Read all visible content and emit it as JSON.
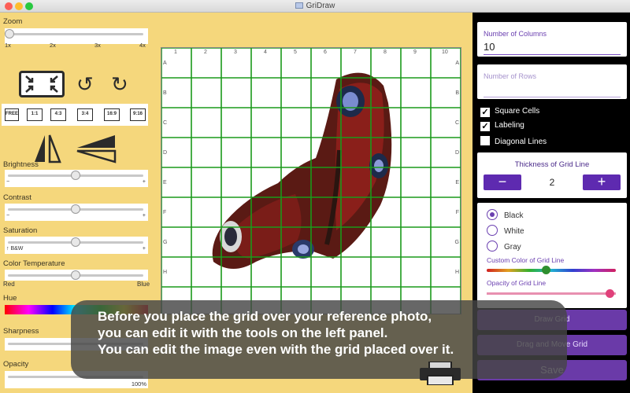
{
  "window": {
    "title": "GriDraw"
  },
  "left_panel": {
    "zoom": {
      "label": "Zoom",
      "ticks": [
        "1x",
        "2x",
        "3x",
        "4x"
      ],
      "value_fraction": 0.0
    },
    "ratios": [
      "FREE",
      "1:1",
      "4:3",
      "3:4",
      "16:9",
      "9:16"
    ],
    "brightness": {
      "label": "Brightness",
      "min": "−",
      "max": "+",
      "value_fraction": 0.5
    },
    "contrast": {
      "label": "Contrast",
      "min": "−",
      "max": "+",
      "value_fraction": 0.5
    },
    "saturation": {
      "label": "Saturation",
      "min": "↑ B&W",
      "max": "+",
      "value_fraction": 0.5
    },
    "color_temperature": {
      "label": "Color Temperature",
      "min": "Red",
      "max": "Blue",
      "value_fraction": 0.5
    },
    "hue": {
      "label": "Hue"
    },
    "sharpness": {
      "label": "Sharpness"
    },
    "opacity": {
      "label": "Opacity",
      "max": "100%"
    }
  },
  "grid": {
    "columns": [
      "1",
      "2",
      "3",
      "4",
      "5",
      "6",
      "7",
      "8",
      "9",
      "10"
    ],
    "rows": [
      "A",
      "B",
      "C",
      "D",
      "E",
      "F",
      "G",
      "H"
    ],
    "line_color": "#1a9a1a"
  },
  "right_panel": {
    "columns_field": {
      "label": "Number of Columns",
      "value": "10"
    },
    "rows_field": {
      "label": "Number of Rows",
      "value": ""
    },
    "checkboxes": [
      {
        "label": "Square Cells",
        "checked": true
      },
      {
        "label": "Labeling",
        "checked": true
      },
      {
        "label": "Diagonal Lines",
        "checked": false
      }
    ],
    "thickness": {
      "title": "Thickness of Grid Line",
      "value": "2",
      "minus": "−",
      "plus": "+"
    },
    "colors": [
      {
        "label": "Black",
        "selected": true
      },
      {
        "label": "White",
        "selected": false
      },
      {
        "label": "Gray",
        "selected": false
      }
    ],
    "custom_color_label": "Custom Color of Grid Line",
    "opacity_label": "Opacity of Grid Line",
    "buttons": {
      "draw": "Draw Grid",
      "drag": "Drag and Move Grid",
      "save": "Save"
    },
    "accent": "#6a3aa8"
  },
  "caption": {
    "lines": [
      "Before you place the grid over your reference photo,",
      "you can edit it with the tools on the left panel.",
      "You can edit the image even with the grid placed over it."
    ]
  }
}
